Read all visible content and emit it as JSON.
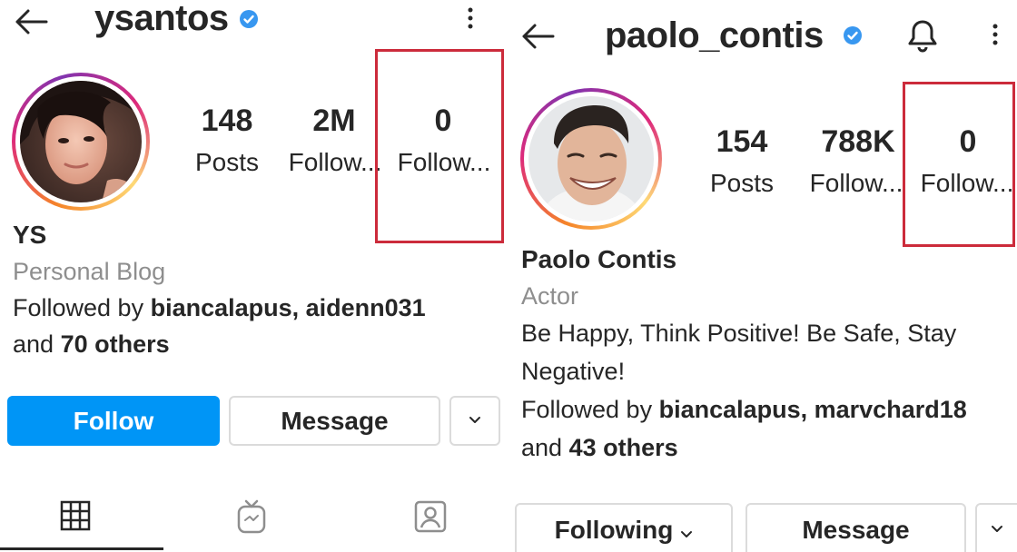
{
  "left_profile": {
    "username": "ysantos",
    "stats": [
      {
        "value": "148",
        "label": "Posts"
      },
      {
        "value": "2M",
        "label": "Follow..."
      },
      {
        "value": "0",
        "label": "Follow..."
      }
    ],
    "name": "YS",
    "category": "Personal Blog",
    "followed_by": {
      "prefix": "Followed by ",
      "users": "biancalapus, aidenn031",
      "and_text": "and ",
      "others": "70 others"
    },
    "buttons": {
      "primary": "Follow",
      "secondary": "Message"
    },
    "tabs": [
      "grid-icon",
      "igtv-icon",
      "tagged-icon"
    ]
  },
  "right_profile": {
    "username": "paolo_contis",
    "stats": [
      {
        "value": "154",
        "label": "Posts"
      },
      {
        "value": "788K",
        "label": "Follow..."
      },
      {
        "value": "0",
        "label": "Follow..."
      }
    ],
    "name": "Paolo Contis",
    "category": "Actor",
    "bio_lines": [
      "Be Happy, Think Positive! Be Safe, Stay",
      "Negative!"
    ],
    "followed_by": {
      "prefix": "Followed by ",
      "users": "biancalapus, marvchard18",
      "and_text": "and ",
      "others": "43 others"
    },
    "buttons": {
      "following": "Following",
      "secondary": "Message"
    }
  },
  "colors": {
    "accent_blue": "#0095f6",
    "verified_blue": "#3897f0",
    "highlight_red": "#cc2b3b",
    "secondary_text": "#8e8e8e"
  }
}
